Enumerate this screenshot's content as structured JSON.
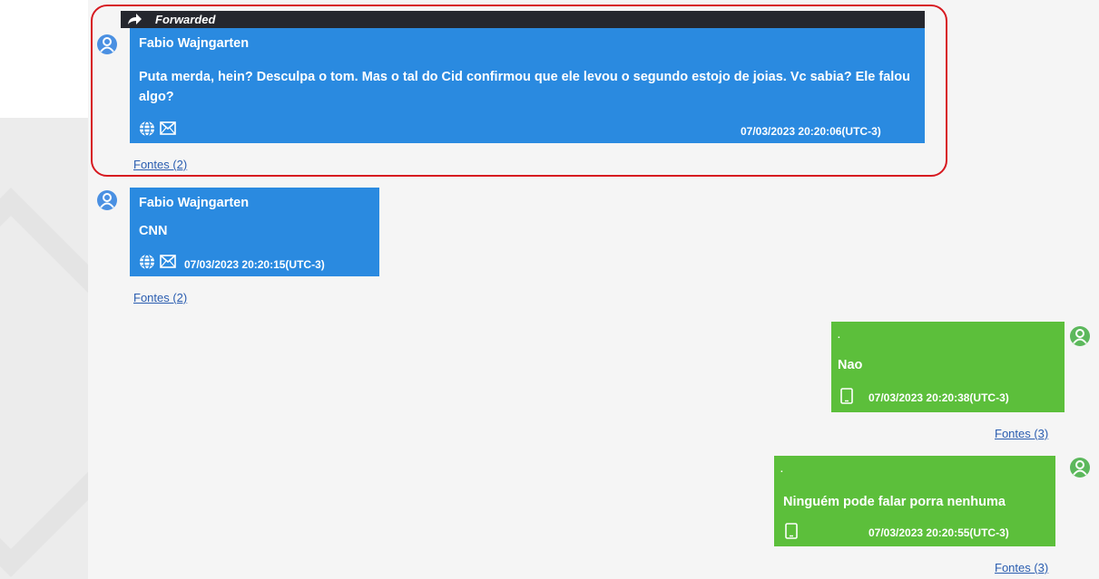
{
  "forwarded_label": "Forwarded",
  "messages": [
    {
      "sender": "Fabio  Wajngarten",
      "text": "Puta merda, hein? Desculpa o tom. Mas o tal do Cid confirmou que ele levou o segundo estojo de joias. Vc sabia? Ele falou algo?",
      "timestamp": "07/03/2023 20:20:06(UTC-3)",
      "sources": "Fontes (2)"
    },
    {
      "sender": "Fabio  Wajngarten",
      "text": "CNN",
      "timestamp": "07/03/2023 20:20:15(UTC-3)",
      "sources": "Fontes (2)"
    },
    {
      "marker": ".",
      "text": "Nao",
      "timestamp": "07/03/2023 20:20:38(UTC-3)",
      "sources": "Fontes (3)"
    },
    {
      "marker": ".",
      "text": "Ninguém pode falar porra nenhuma",
      "timestamp": "07/03/2023 20:20:55(UTC-3)",
      "sources": "Fontes (3)"
    }
  ],
  "colors": {
    "incoming_bubble": "#2a8ae0",
    "outgoing_bubble": "#5cbf3b",
    "forwarded_bar": "#25272e",
    "highlight_border": "#d71920",
    "link": "#2a5db0"
  },
  "icons": {
    "contact_avatar": "person-icon",
    "globe": "globe-icon",
    "mail": "envelope-icon",
    "device": "phone-icon",
    "forward": "forward-arrow-icon"
  }
}
